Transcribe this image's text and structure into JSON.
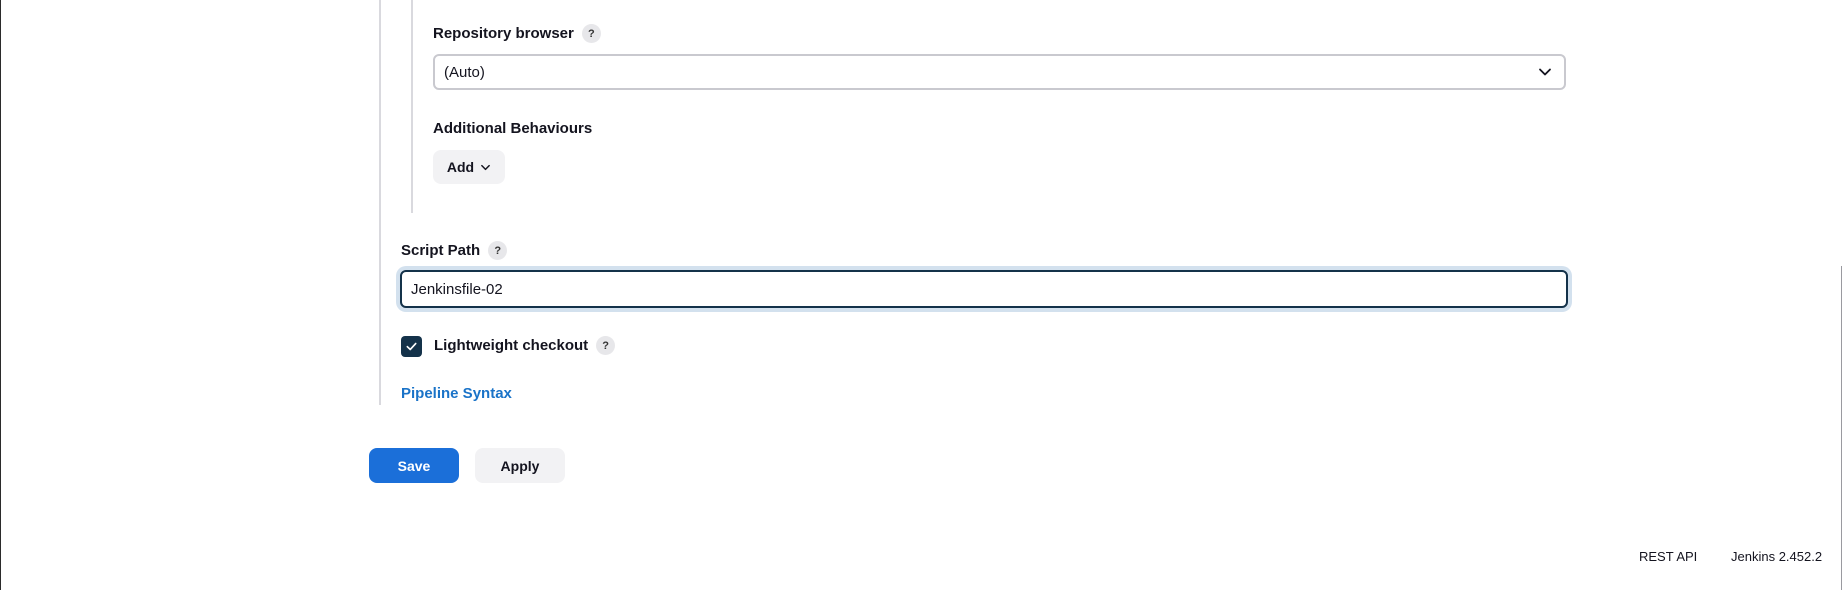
{
  "repository_browser": {
    "label": "Repository browser",
    "help": "?",
    "selected": "(Auto)"
  },
  "additional_behaviours": {
    "label": "Additional Behaviours",
    "add_label": "Add"
  },
  "script_path": {
    "label": "Script Path",
    "help": "?",
    "value": "Jenkinsfile-02"
  },
  "lightweight_checkout": {
    "label": "Lightweight checkout",
    "help": "?",
    "checked": true
  },
  "pipeline_syntax_link": "Pipeline Syntax",
  "actions": {
    "save_label": "Save",
    "apply_label": "Apply"
  },
  "footer": {
    "rest_api": "REST API",
    "version": "Jenkins 2.452.2"
  },
  "colors": {
    "primary": "#1b6fd9",
    "checkbox": "#14324a",
    "link": "#1a73c8"
  },
  "icons": {
    "select_chevron": "chevron-down-icon",
    "add_chevron": "chevron-down-icon",
    "checkbox_mark": "check-icon"
  }
}
